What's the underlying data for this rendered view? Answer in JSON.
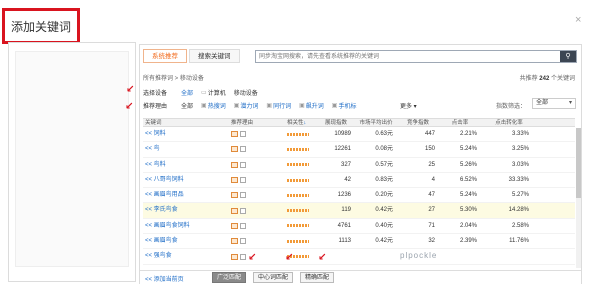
{
  "dialog": {
    "title": "添加关键词",
    "close_icon": "×"
  },
  "tabs": [
    {
      "label": "系统推荐",
      "active": true
    },
    {
      "label": "搜索关键词",
      "active": false
    }
  ],
  "search": {
    "placeholder": "同步淘宝网搜索，请先查看系统推荐的关键词",
    "icon": "search-icon"
  },
  "breadcrumb": "所有推荐词 > 移动设备",
  "total": {
    "prefix": "共推荐",
    "count": "242",
    "suffix": "个关键词"
  },
  "device_filter": {
    "label": "选择设备",
    "options": [
      {
        "label": "全部",
        "selected": true,
        "icon": ""
      },
      {
        "label": "计算机",
        "selected": false,
        "icon": "pc-icon"
      },
      {
        "label": "移动设备",
        "selected": false,
        "icon": ""
      }
    ]
  },
  "reason_filter": {
    "label": "推荐理由",
    "options": [
      {
        "label": "全部",
        "selected": false
      },
      {
        "label": "热搜词",
        "selected": true
      },
      {
        "label": "潜力词",
        "selected": true
      },
      {
        "label": "同行词",
        "selected": true
      },
      {
        "label": "飙升词",
        "selected": true
      },
      {
        "label": "手机标",
        "selected": true
      }
    ],
    "more": "更多 ▾"
  },
  "index_filter": {
    "label": "指数筛选：",
    "value": "全部"
  },
  "table": {
    "headers": [
      "关键词",
      "推荐理由",
      "相关性",
      "展现指数",
      "市场平均出价",
      "竞争指数",
      "点击率",
      "点击转化率"
    ],
    "sort_indicator": "↓",
    "rows": [
      {
        "keyword": "<< 饲料",
        "pv": "10989",
        "bid": "0.63元",
        "comp": "447",
        "ctr": "2.21%",
        "cvr": "3.33%",
        "hl": false
      },
      {
        "keyword": "<< 鸟",
        "pv": "12261",
        "bid": "0.08元",
        "comp": "150",
        "ctr": "5.24%",
        "cvr": "3.25%",
        "hl": false
      },
      {
        "keyword": "<< 鸟料",
        "pv": "327",
        "bid": "0.57元",
        "comp": "25",
        "ctr": "5.26%",
        "cvr": "3.03%",
        "hl": false
      },
      {
        "keyword": "<< 八哥鸟饲料",
        "pv": "42",
        "bid": "0.83元",
        "comp": "4",
        "ctr": "6.52%",
        "cvr": "33.33%",
        "hl": false
      },
      {
        "keyword": "<< 画眉鸟用品",
        "pv": "1236",
        "bid": "0.20元",
        "comp": "47",
        "ctr": "5.24%",
        "cvr": "5.27%",
        "hl": false
      },
      {
        "keyword": "<< 李氏鸟食",
        "pv": "119",
        "bid": "0.42元",
        "comp": "27",
        "ctr": "5.30%",
        "cvr": "14.28%",
        "hl": true
      },
      {
        "keyword": "<< 画眉鸟食饲料",
        "pv": "4761",
        "bid": "0.40元",
        "comp": "71",
        "ctr": "2.04%",
        "cvr": "2.58%",
        "hl": false
      },
      {
        "keyword": "<< 画眉鸟食",
        "pv": "1113",
        "bid": "0.42元",
        "comp": "32",
        "ctr": "2.39%",
        "cvr": "11.76%",
        "hl": false
      },
      {
        "keyword": "<< 强鸟食",
        "pv": "",
        "bid": "",
        "comp": "",
        "ctr": "",
        "cvr": "",
        "hl": false
      }
    ]
  },
  "footer": {
    "add_page": "<< 添加当前页",
    "match_buttons": [
      "广泛匹配",
      "中心词匹配",
      "精确匹配"
    ]
  },
  "watermark": "plpockle"
}
